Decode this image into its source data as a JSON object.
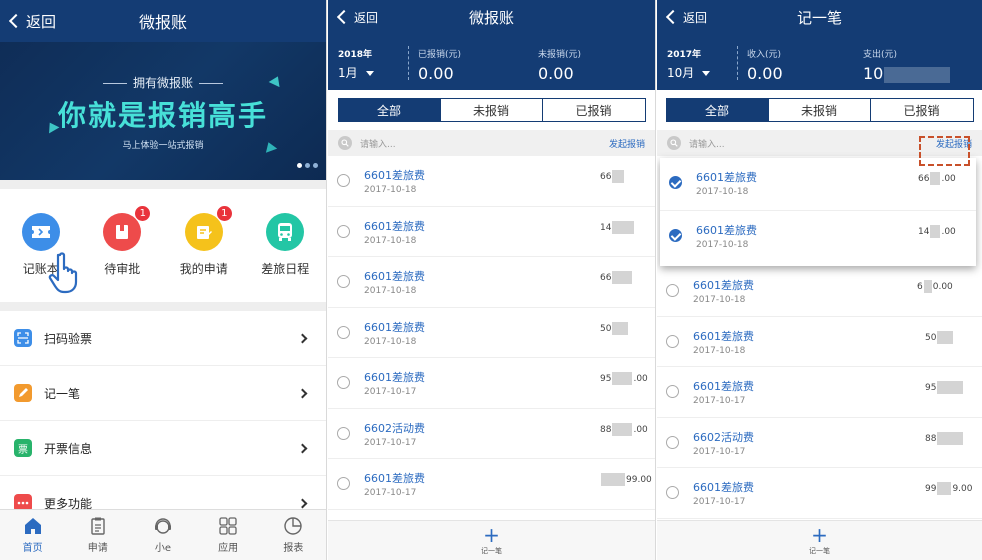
{
  "panel1": {
    "back_label": "返回",
    "title": "微报账",
    "banner": {
      "sub": "拥有微报账",
      "headline": "你就是报销高手",
      "tagline": "马上体验一站式报销"
    },
    "quick_actions": [
      {
        "label": "记账本",
        "color": "#3d8ee8",
        "badge": ""
      },
      {
        "label": "待审批",
        "color": "#ee4b4b",
        "badge": "1"
      },
      {
        "label": "我的申请",
        "color": "#f5c21b",
        "badge": "1"
      },
      {
        "label": "差旅日程",
        "color": "#23c6a5",
        "badge": ""
      }
    ],
    "menu": [
      {
        "label": "扫码验票",
        "color": "#3d8ee8",
        "icon": "scan-icon"
      },
      {
        "label": "记一笔",
        "color": "#f29a2e",
        "icon": "pencil-icon"
      },
      {
        "label": "开票信息",
        "color": "#28b36b",
        "icon": "invoice-icon",
        "glyph": "票"
      },
      {
        "label": "更多功能",
        "color": "#ee4b4b",
        "icon": "more-icon"
      }
    ],
    "tabs": [
      {
        "label": "首页",
        "active": true
      },
      {
        "label": "申请",
        "active": false
      },
      {
        "label": "小e",
        "active": false
      },
      {
        "label": "应用",
        "active": false
      },
      {
        "label": "报表",
        "active": false
      }
    ]
  },
  "panel2": {
    "back_label": "返回",
    "title": "微报账",
    "year": "2018年",
    "month": "1月",
    "stat1_label": "已报销(元)",
    "stat1_value": "0.00",
    "stat2_label": "未报销(元)",
    "stat2_value": "0.00",
    "segments": [
      "全部",
      "未报销",
      "已报销"
    ],
    "search_placeholder": "请输入...",
    "search_action": "发起报销",
    "rows": [
      {
        "title": "6601差旅费",
        "date": "2017-10-18",
        "amount_prefix": "66",
        "amount_suffix": ""
      },
      {
        "title": "6601差旅费",
        "date": "2017-10-18",
        "amount_prefix": "14",
        "amount_suffix": ""
      },
      {
        "title": "6601差旅费",
        "date": "2017-10-18",
        "amount_prefix": "66",
        "amount_suffix": ""
      },
      {
        "title": "6601差旅费",
        "date": "2017-10-18",
        "amount_prefix": "50",
        "amount_suffix": ""
      },
      {
        "title": "6601差旅费",
        "date": "2017-10-17",
        "amount_prefix": "95",
        "amount_suffix": ".00"
      },
      {
        "title": "6602活动费",
        "date": "2017-10-17",
        "amount_prefix": "88",
        "amount_suffix": ".00"
      },
      {
        "title": "6601差旅费",
        "date": "2017-10-17",
        "amount_prefix": "",
        "amount_suffix": "99.00"
      }
    ],
    "bottom_label": "记一笔"
  },
  "panel3": {
    "back_label": "返回",
    "title": "记一笔",
    "year": "2017年",
    "month": "10月",
    "stat1_label": "收入(元)",
    "stat1_value": "0.00",
    "stat2_label": "支出(元)",
    "stat2_value": "10",
    "segments": [
      "全部",
      "未报销",
      "已报销"
    ],
    "search_placeholder": "请输入...",
    "search_action": "发起报销",
    "selected_rows": [
      {
        "title": "6601差旅费",
        "date": "2017-10-18",
        "amount_prefix": "66",
        "amount_suffix": ".00"
      },
      {
        "title": "6601差旅费",
        "date": "2017-10-18",
        "amount_prefix": "14",
        "amount_suffix": ".00"
      }
    ],
    "rows": [
      {
        "title": "6601差旅费",
        "date": "2017-10-18",
        "amount_prefix": "6",
        "amount_suffix": "0.00"
      },
      {
        "title": "6601差旅费",
        "date": "2017-10-18",
        "amount_prefix": "50",
        "amount_suffix": ""
      },
      {
        "title": "6601差旅费",
        "date": "2017-10-17",
        "amount_prefix": "95",
        "amount_suffix": ""
      },
      {
        "title": "6602活动费",
        "date": "2017-10-17",
        "amount_prefix": "88",
        "amount_suffix": ""
      },
      {
        "title": "6601差旅费",
        "date": "2017-10-17",
        "amount_prefix": "99",
        "amount_suffix": "9.00"
      }
    ],
    "bottom_label": "记一笔"
  }
}
